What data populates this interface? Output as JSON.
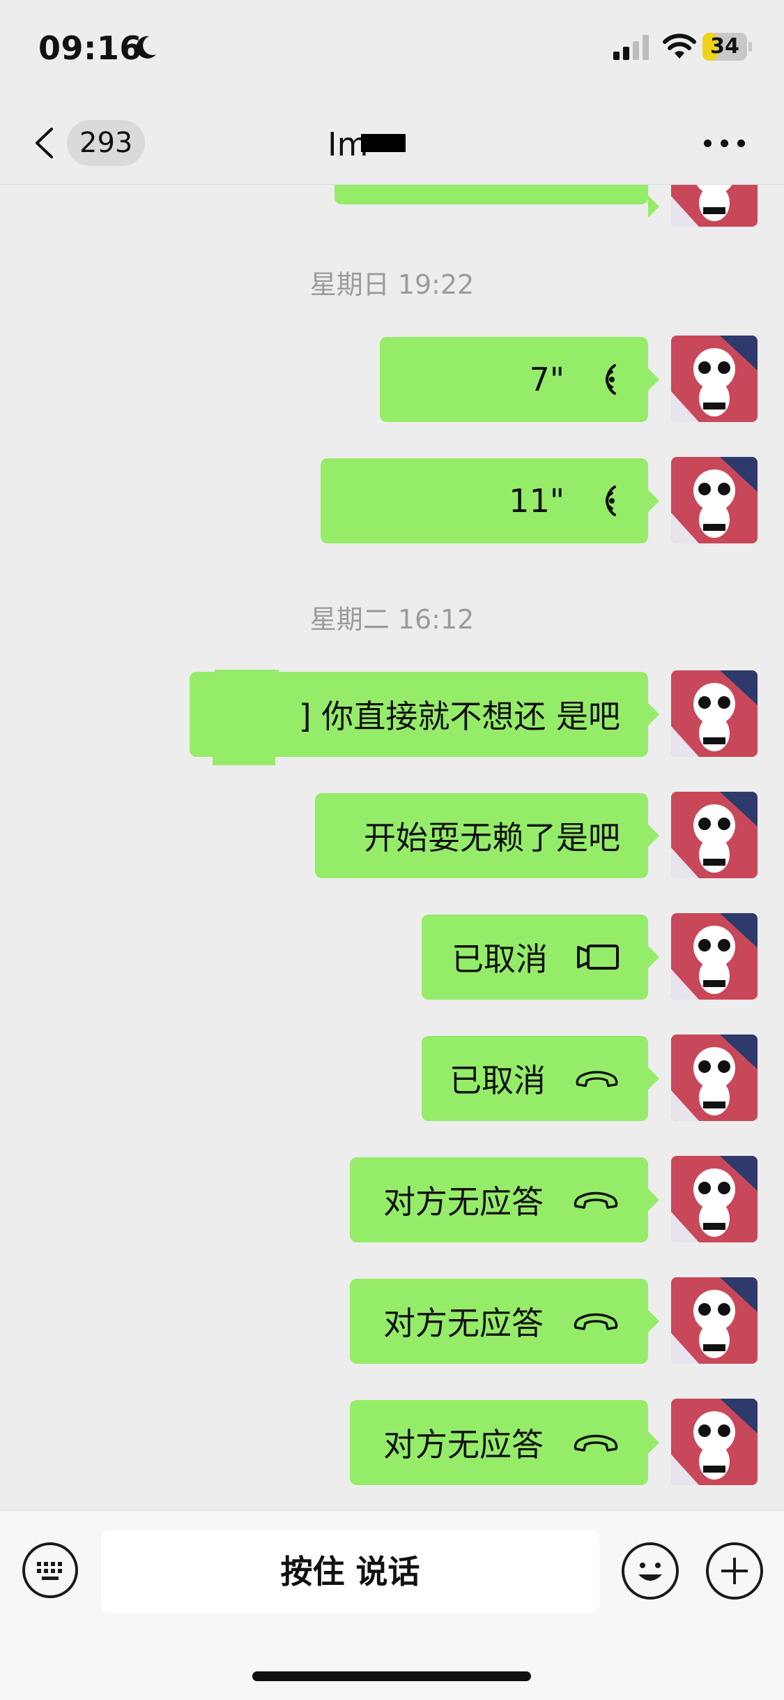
{
  "status_bar": {
    "time": "09:16",
    "battery": "34",
    "battery_level": 0.34
  },
  "nav": {
    "unread_count": "293",
    "title": "Im",
    "more_icon": "more-dots-icon",
    "back_icon": "chevron-left-icon"
  },
  "chat": {
    "timestamps": [
      "星期日 19:22",
      "星期二 16:12"
    ],
    "messages": [
      {
        "kind": "voice",
        "text": "7\"",
        "icon": "voice-wave-icon"
      },
      {
        "kind": "voice",
        "text": "11\"",
        "icon": "voice-wave-icon"
      },
      {
        "kind": "text",
        "text": "] 你直接就不想还 是吧"
      },
      {
        "kind": "text",
        "text": "开始耍无赖了是吧"
      },
      {
        "kind": "video-call",
        "text": "已取消",
        "icon": "video-camera-icon"
      },
      {
        "kind": "voice-call",
        "text": "已取消",
        "icon": "phone-icon"
      },
      {
        "kind": "voice-call",
        "text": "对方无应答",
        "icon": "phone-icon"
      },
      {
        "kind": "voice-call",
        "text": "对方无应答",
        "icon": "phone-icon"
      },
      {
        "kind": "voice-call",
        "text": "对方无应答",
        "icon": "phone-icon"
      }
    ]
  },
  "input_bar": {
    "hold_to_talk": "按住 说话",
    "keyboard_icon": "keyboard-icon",
    "emoji_icon": "emoji-icon",
    "plus_icon": "plus-icon"
  },
  "colors": {
    "bubble": "#95ec69",
    "background": "#ededed",
    "timestamp": "#9b9b9b"
  }
}
